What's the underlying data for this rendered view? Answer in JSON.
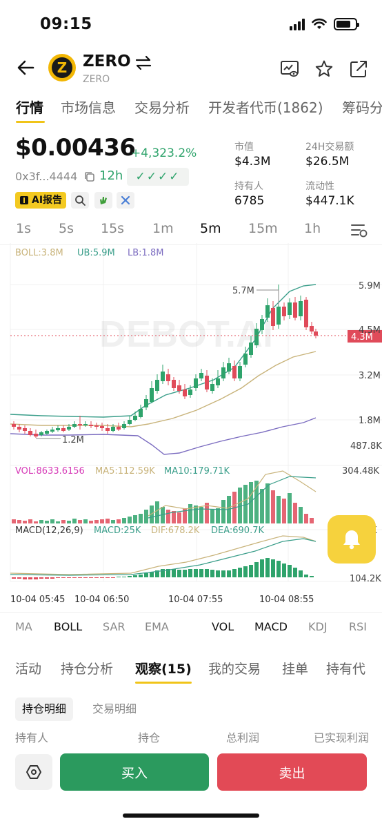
{
  "status": {
    "time": "09:15"
  },
  "header": {
    "token_symbol": "ZERO",
    "token_name": "ZERO",
    "logo_letter": "Z"
  },
  "main_tabs": [
    "行情",
    "市场信息",
    "交易分析",
    "开发者代币(1862)",
    "筹码分"
  ],
  "price": {
    "value": "$0.00436",
    "change": "+4,323.2%",
    "address": "0x3f...4444",
    "age": "12h",
    "checks": "✓✓✓✓"
  },
  "ai_report": "AI报告",
  "stats": {
    "market_cap_label": "市值",
    "market_cap": "$4.3M",
    "volume_label": "24H交易额",
    "volume": "$26.5M",
    "holders_label": "持有人",
    "holders": "6785",
    "liquidity_label": "流动性",
    "liquidity": "$447.1K"
  },
  "intervals": [
    "1s",
    "5s",
    "15s",
    "1m",
    "5m",
    "15m",
    "1h"
  ],
  "active_interval": "5m",
  "chart": {
    "watermark": "DEBOT.AI",
    "boll_legend": {
      "boll": "BOLL:3.8M",
      "ub": "UB:5.9M",
      "lb": "LB:1.8M"
    },
    "y_labels": [
      "5.9M",
      "4.5M",
      "3.2M",
      "1.8M",
      "487.8K"
    ],
    "current_price_tag": "4.3M",
    "high_label": "5.7M",
    "low_label": "1.2M",
    "vol_legend": {
      "vol": "VOL:8633.6156",
      "ma5": "MA5:112.59K",
      "ma10": "MA10:179.71K"
    },
    "vol_max": "304.48K",
    "vol_partial": "K",
    "macd_legend": {
      "macd": "MACD(12,26,9)",
      "hist": "MACD:25K",
      "dif": "DIF:678.2K",
      "dea": "DEA:690.7K"
    },
    "macd_label": "104.2K",
    "x_labels": [
      "10-04 05:45",
      "10-04 06:50",
      "10-04 07:55",
      "10-04 08:55"
    ]
  },
  "chart_data": {
    "type": "candlestick",
    "x": [
      "10-04 05:45",
      "10-04 06:50",
      "10-04 07:55",
      "10-04 08:55"
    ],
    "price_axis": [
      "487.8K",
      "1.8M",
      "3.2M",
      "4.5M",
      "5.9M"
    ],
    "current_price": "4.3M",
    "high": "5.7M",
    "low": "1.2M",
    "boll": {
      "mid": "3.8M",
      "upper": "5.9M",
      "lower": "1.8M"
    },
    "volume": {
      "last": "8633.6156",
      "ma5": "112.59K",
      "ma10": "179.71K",
      "max": "304.48K"
    },
    "macd": {
      "params": "12,26,9",
      "macd": "25K",
      "dif": "678.2K",
      "dea": "690.7K",
      "axis": "104.2K"
    },
    "colors": {
      "up": "#2ea36b",
      "down": "#e04b5a"
    }
  },
  "indicators": [
    "MA",
    "BOLL",
    "SAR",
    "EMA",
    "VOL",
    "MACD",
    "KDJ",
    "RSI"
  ],
  "active_indicators": [
    "BOLL",
    "VOL",
    "MACD"
  ],
  "lower_tabs": [
    "活动",
    "持仓分析",
    "观察(15)",
    "我的交易",
    "挂单",
    "持有代"
  ],
  "sub_tabs": [
    "持仓明细",
    "交易明细"
  ],
  "columns": [
    "持有人",
    "持仓",
    "总利润",
    "已实现利润"
  ],
  "actions": {
    "buy": "买入",
    "sell": "卖出"
  },
  "colors": {
    "accent": "#f0c419",
    "up": "#2ea36b",
    "down": "#e04b5a"
  }
}
